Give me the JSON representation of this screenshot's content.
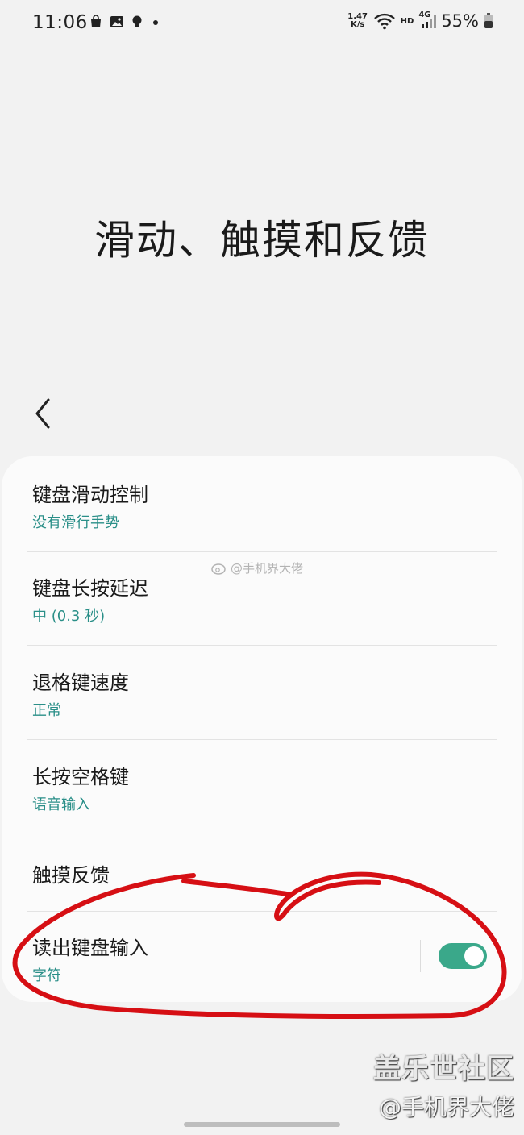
{
  "status_bar": {
    "time": "11:06",
    "speed_value": "1.47",
    "speed_unit": "K/s",
    "hd": "HD",
    "network": "4G",
    "battery": "55%"
  },
  "page": {
    "title": "滑动、触摸和反馈"
  },
  "settings": [
    {
      "label": "键盘滑动控制",
      "value": "没有滑行手势"
    },
    {
      "label": "键盘长按延迟",
      "value": "中 (0.3 秒)"
    },
    {
      "label": "退格键速度",
      "value": "正常"
    },
    {
      "label": "长按空格键",
      "value": "语音输入"
    },
    {
      "label": "触摸反馈"
    },
    {
      "label": "读出键盘输入",
      "value": "字符",
      "toggle": true
    }
  ],
  "watermarks": {
    "center": "@手机界大佬",
    "brand": "盖乐世社区",
    "handle": "@手机界大佬"
  },
  "colors": {
    "accent": "#2a8f88",
    "toggle_on": "#3aa88a",
    "annotation_red": "#d60f14"
  }
}
